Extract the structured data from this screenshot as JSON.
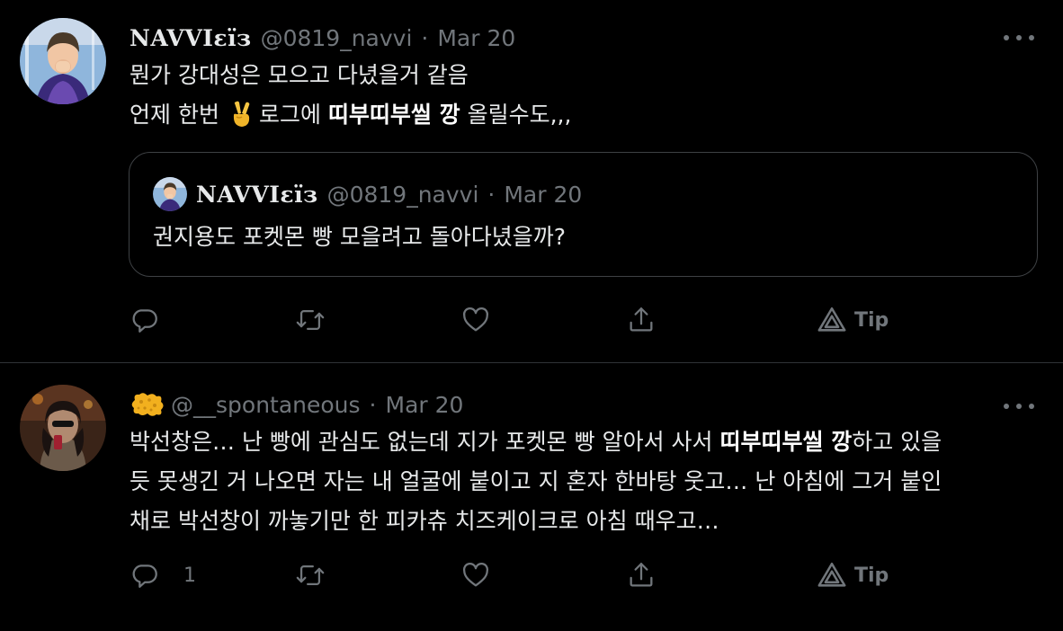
{
  "tweets": [
    {
      "display_name": "NAVVIεïз",
      "handle": "@0819_navvi",
      "separator": "·",
      "date": "Mar 20",
      "lines": [
        {
          "text": "뭔가 강대성은 모으고 다녔을거 같음"
        },
        {
          "pre": "언제 한번",
          "emoji": "victory-hand-icon",
          "mid": "로그에 ",
          "bold": "띠부띠부씰 깡",
          "post": " 올릴수도,,,"
        }
      ],
      "quote": {
        "display_name": "NAVVIεïз",
        "handle": "@0819_navvi",
        "separator": "·",
        "date": "Mar 20",
        "text": "권지용도 포켓몬 빵 모을려고 돌아다녔을까?"
      },
      "actions": {
        "reply_count": "",
        "tip_label": "Tip"
      }
    },
    {
      "display_name": "",
      "name_emoji": "sponge-icon",
      "handle": "@__spontaneous",
      "separator": "·",
      "date": "Mar 20",
      "lines": [
        {
          "pre": "박선창은… 난 빵에 관심도 없는데 지가 포켓몬 빵 알아서 사서 ",
          "bold": "띠부띠부씰 깡",
          "post": "하고 있을"
        },
        {
          "text": "듯 못생긴 거 나오면 자는 내 얼굴에 붙이고 지 혼자 한바탕 웃고… 난 아침에 그거 붙인"
        },
        {
          "text": "채로 박선창이 까놓기만 한 피카츄 치즈케이크로 아침 때우고…"
        }
      ],
      "actions": {
        "reply_count": "1",
        "tip_label": "Tip"
      }
    }
  ],
  "colors": {
    "background": "#000000",
    "text": "#e7e9ea",
    "secondary": "#71767b",
    "border": "#2f3336"
  }
}
